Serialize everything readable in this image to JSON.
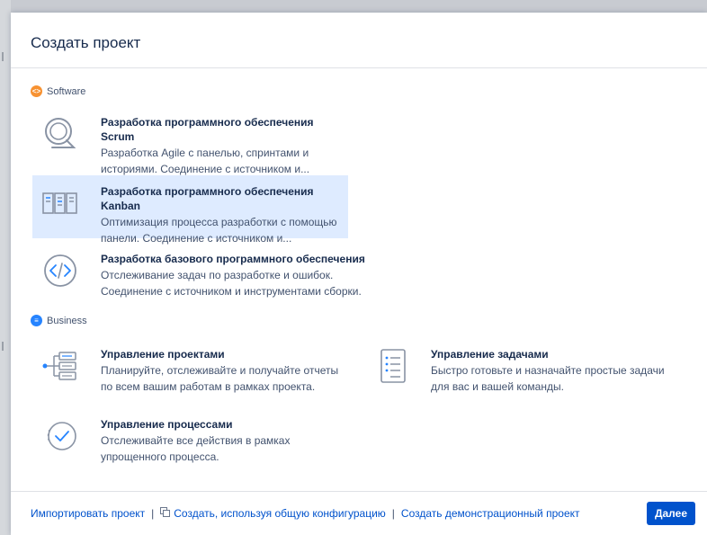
{
  "dialog": {
    "title": "Создать проект"
  },
  "sections": {
    "software": {
      "label": "Software",
      "badge_glyph": "<>"
    },
    "business": {
      "label": "Business",
      "badge_glyph": "≡"
    }
  },
  "templates": {
    "scrum": {
      "title": "Разработка программного обеспечения Scrum",
      "desc1": "Разработка Agile с панелью, спринтами и",
      "desc2": "историями. Соединение с источником и...",
      "icon": "scrum-cycle-icon"
    },
    "kanban": {
      "title": "Разработка программного обеспечения Kanban",
      "desc1": "Оптимизация процесса разработки с помощью",
      "desc2": "панели. Соединение с источником и...",
      "icon": "kanban-board-icon",
      "selected": true
    },
    "basic": {
      "title": "Разработка базового программного обеспечения",
      "desc1": "Отслеживание задач по разработке и ошибок.",
      "desc2": "Соединение с источником и инструментами сборки.",
      "icon": "code-brackets-icon"
    },
    "project_mgmt": {
      "title": "Управление проектами",
      "desc1": "Планируйте, отслеживайте и получайте отчеты",
      "desc2": "по всем вашим работам в рамках проекта.",
      "icon": "project-tree-icon"
    },
    "task_mgmt": {
      "title": "Управление задачами",
      "desc1": "Быстро готовьте и назначайте простые задачи",
      "desc2": "для вас и вашей команды.",
      "icon": "checklist-icon"
    },
    "process_mgmt": {
      "title": "Управление процессами",
      "desc1": "Отслеживайте все действия в рамках",
      "desc2": "упрощенного процесса.",
      "icon": "process-check-icon"
    }
  },
  "footer": {
    "import_label": "Импортировать проект",
    "separator": "|",
    "shared_config_label": "Создать, используя общую конфигурацию",
    "demo_label": "Создать демонстрационный проект",
    "next_label": "Далее"
  },
  "colors": {
    "accent": "#0052cc",
    "selected_bg": "#deebff",
    "software_badge": "#f79232",
    "business_badge": "#2684ff"
  }
}
